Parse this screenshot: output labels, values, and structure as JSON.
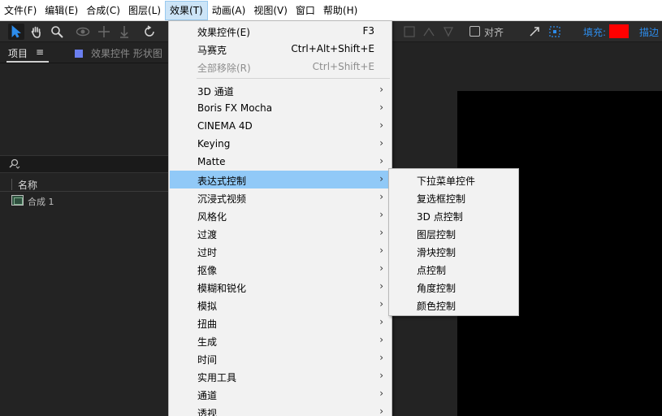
{
  "menubar": {
    "items": [
      {
        "label": "文件(F)"
      },
      {
        "label": "编辑(E)"
      },
      {
        "label": "合成(C)"
      },
      {
        "label": "图层(L)"
      },
      {
        "label": "效果(T)",
        "active": true
      },
      {
        "label": "动画(A)"
      },
      {
        "label": "视图(V)"
      },
      {
        "label": "窗口"
      },
      {
        "label": "帮助(H)"
      }
    ]
  },
  "toolbar": {
    "snap_label": "对齐",
    "fill_label": "填充:",
    "fill_color": "#ff0000",
    "stroke_label": "描边"
  },
  "left_panel": {
    "tab_project": "项目",
    "tab_menu_glyph": "≡",
    "tab_effects": "效果控件 形状图",
    "column_name": "名称",
    "items": [
      {
        "name": "合成 1"
      }
    ]
  },
  "effects_menu": {
    "items": [
      {
        "label": "效果控件(E)",
        "shortcut": "F3"
      },
      {
        "label": "马赛克",
        "shortcut": "Ctrl+Alt+Shift+E"
      },
      {
        "label": "全部移除(R)",
        "shortcut": "Ctrl+Shift+E",
        "disabled": true
      },
      {
        "label": "3D 通道",
        "submenu": true
      },
      {
        "label": "Boris FX Mocha",
        "submenu": true
      },
      {
        "label": "CINEMA 4D",
        "submenu": true
      },
      {
        "label": "Keying",
        "submenu": true
      },
      {
        "label": "Matte",
        "submenu": true
      },
      {
        "label": "表达式控制",
        "submenu": true,
        "highlighted": true
      },
      {
        "label": "沉浸式视频",
        "submenu": true
      },
      {
        "label": "风格化",
        "submenu": true
      },
      {
        "label": "过渡",
        "submenu": true
      },
      {
        "label": "过时",
        "submenu": true
      },
      {
        "label": "抠像",
        "submenu": true
      },
      {
        "label": "模糊和锐化",
        "submenu": true
      },
      {
        "label": "模拟",
        "submenu": true
      },
      {
        "label": "扭曲",
        "submenu": true
      },
      {
        "label": "生成",
        "submenu": true
      },
      {
        "label": "时间",
        "submenu": true
      },
      {
        "label": "实用工具",
        "submenu": true
      },
      {
        "label": "通道",
        "submenu": true
      },
      {
        "label": "透视",
        "submenu": true
      }
    ]
  },
  "expression_controls_submenu": {
    "items": [
      {
        "label": "下拉菜单控件"
      },
      {
        "label": "复选框控制"
      },
      {
        "label": "3D 点控制"
      },
      {
        "label": "图层控制"
      },
      {
        "label": "滑块控制"
      },
      {
        "label": "点控制"
      },
      {
        "label": "角度控制"
      },
      {
        "label": "颜色控制"
      }
    ]
  },
  "icons": {
    "selection": "selection-arrow-icon",
    "hand": "hand-icon",
    "zoom": "zoom-icon",
    "search": "search-icon",
    "submenu_arrow": "chevron-right-icon"
  }
}
